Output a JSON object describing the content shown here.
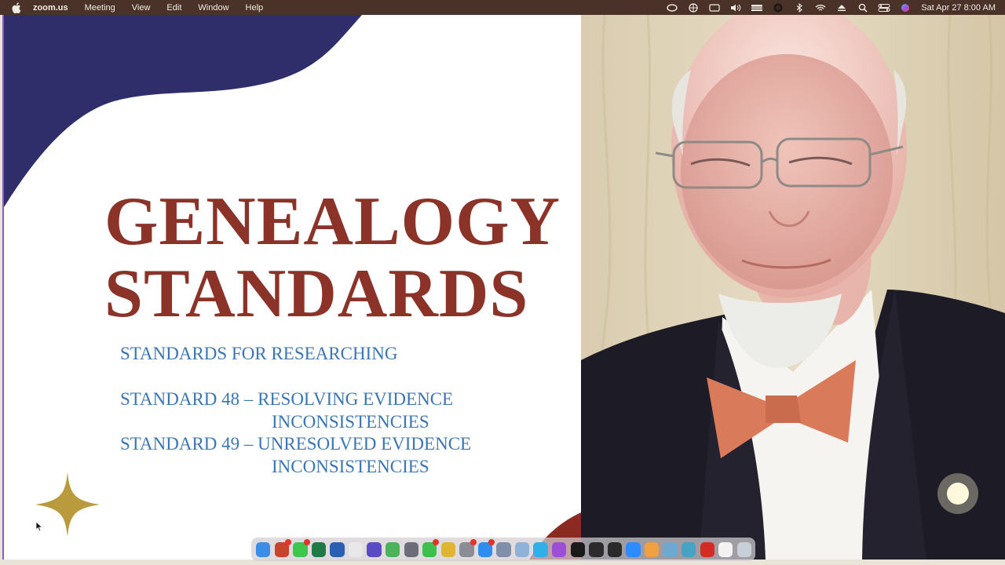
{
  "menubar": {
    "app_name": "zoom.us",
    "items": [
      "Meeting",
      "View",
      "Edit",
      "Window",
      "Help"
    ],
    "clock": "Sat Apr 27  8:00 AM",
    "status_icons": [
      "creative-cloud-icon",
      "keyboard-language-icon",
      "caption-icon",
      "volume-icon",
      "display-icon",
      "record-icon",
      "bluetooth-icon",
      "wifi-icon",
      "eject-icon",
      "search-icon",
      "control-center-icon",
      "siri-icon"
    ]
  },
  "slide": {
    "title_line1": "GENEALOGY",
    "title_line2": "STANDARDS",
    "subtitle": "STANDARDS FOR RESEARCHING",
    "standard48_line1": "STANDARD 48 – RESOLVING EVIDENCE",
    "standard48_line2": "INCONSISTENCIES",
    "standard49_line1": "STANDARD 49 – UNRESOLVED EVIDENCE",
    "standard49_line2": "INCONSISTENCIES",
    "colors": {
      "title": "#8b3328",
      "body": "#3a76b5",
      "wave": "#2f2e6b",
      "accent": "#b99a3c"
    }
  },
  "video": {
    "subject": "presenter-webcam-feed"
  },
  "dock": {
    "icons": [
      {
        "name": "finder-icon",
        "color": "#3b8ee8"
      },
      {
        "name": "powerpoint-icon",
        "color": "#c8432b",
        "badge": true
      },
      {
        "name": "messages-icon",
        "color": "#3ec74f",
        "badge": true
      },
      {
        "name": "excel-icon",
        "color": "#1f7a45"
      },
      {
        "name": "word-icon",
        "color": "#2b5fb3"
      },
      {
        "name": "slack-icon",
        "color": "#e8e8e8"
      },
      {
        "name": "imovie-icon",
        "color": "#5a4bc4"
      },
      {
        "name": "maps-icon",
        "color": "#4db35b"
      },
      {
        "name": "launchpad-icon",
        "color": "#6d6d7a"
      },
      {
        "name": "facetime-icon",
        "color": "#3fbf4d",
        "badge": true
      },
      {
        "name": "chrome-icon",
        "color": "#e0b531"
      },
      {
        "name": "settings-icon",
        "color": "#8c8c94",
        "badge": true
      },
      {
        "name": "app-store-icon",
        "color": "#2f8df2",
        "badge": true
      },
      {
        "name": "preview-icon",
        "color": "#7f8fa8"
      },
      {
        "name": "drive-icon",
        "color": "#8fb2d9"
      },
      {
        "name": "safari-icon",
        "color": "#2fb0e8"
      },
      {
        "name": "podcasts-icon",
        "color": "#9b4fd6"
      },
      {
        "name": "apple-tv-icon",
        "color": "#1a1a1a"
      },
      {
        "name": "obs-icon",
        "color": "#2b2b2b"
      },
      {
        "name": "compass-icon",
        "color": "#2a2a2a"
      },
      {
        "name": "zoom-icon",
        "color": "#2d8cff"
      },
      {
        "name": "photos-icon",
        "color": "#f0a040"
      },
      {
        "name": "camera-icon",
        "color": "#6fa8d0"
      },
      {
        "name": "magnifier-icon",
        "color": "#47a3c4"
      },
      {
        "name": "acrobat-icon",
        "color": "#d42b24"
      },
      {
        "name": "calendar-icon",
        "color": "#f2f2f2"
      },
      {
        "name": "trash-icon",
        "color": "#c9cfd6"
      }
    ]
  }
}
